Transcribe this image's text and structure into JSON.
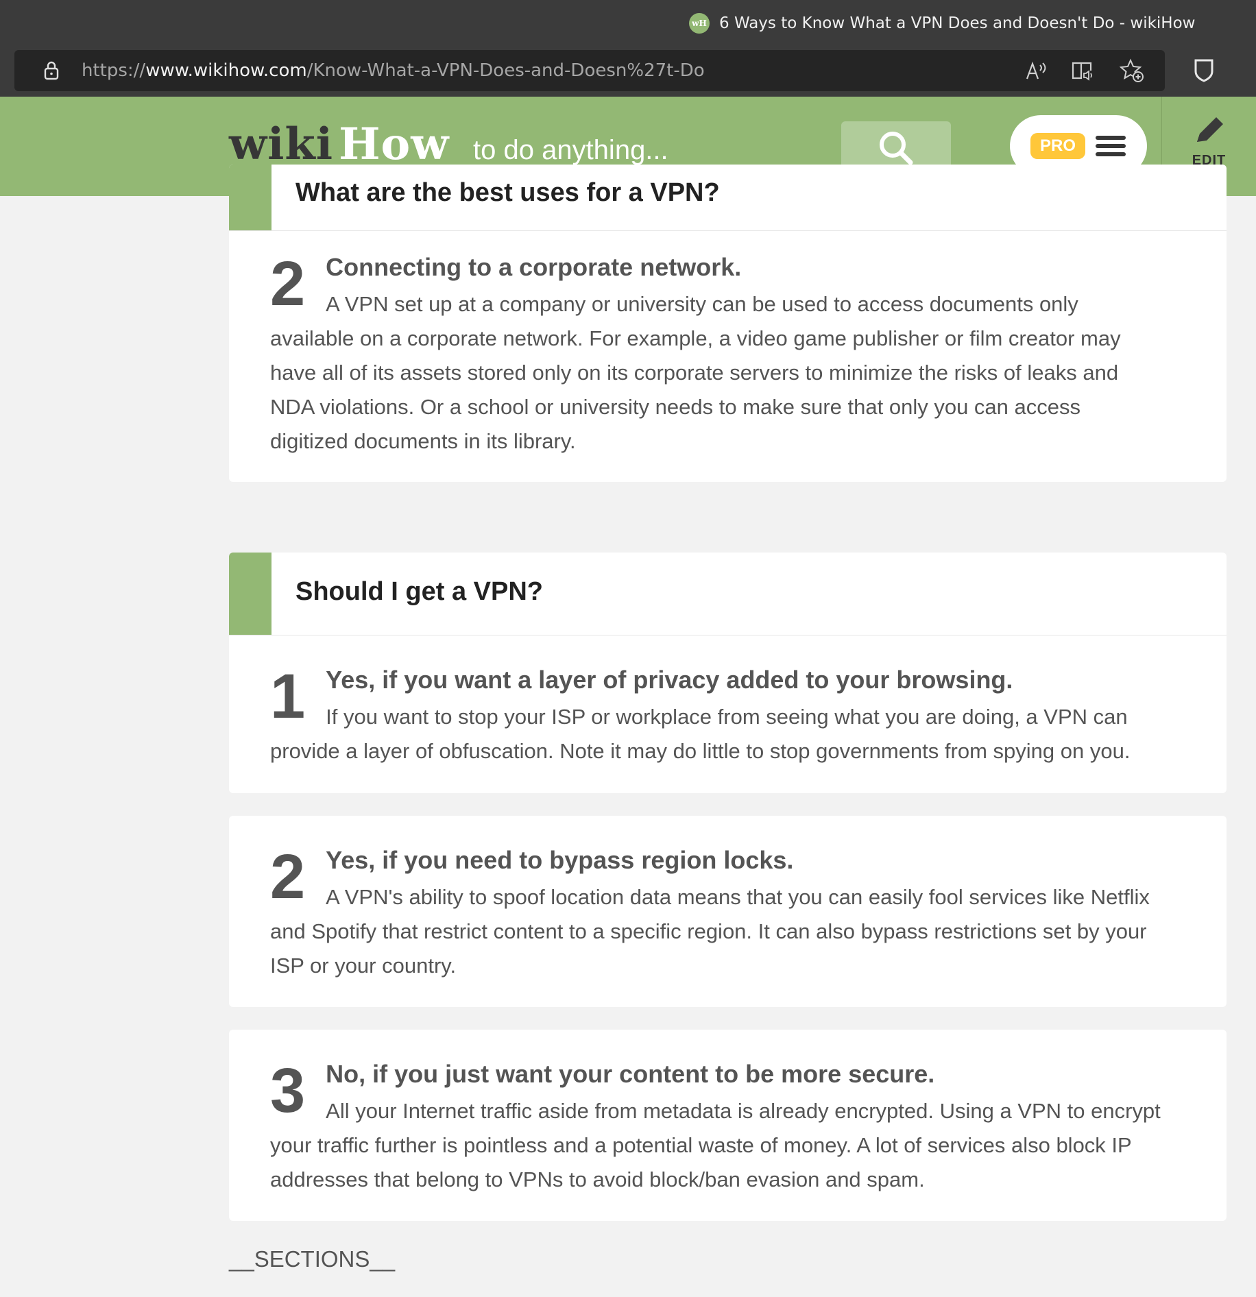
{
  "browser": {
    "tab_title": "6 Ways to Know What a VPN Does and Doesn't Do - wikiHow",
    "favicon_text": "wH",
    "url_scheme": "https://",
    "url_host": "www.wikihow.com",
    "url_path": "/Know-What-a-VPN-Does-and-Doesn%27t-Do"
  },
  "header": {
    "logo_wiki": "wiki",
    "logo_how": "How",
    "search_placeholder": "to do anything...",
    "pro_label": "PRO",
    "edit_label": "EDIT",
    "accent_color": "#93b874",
    "pro_color": "#ffc73a"
  },
  "previous_section": {
    "title": "What are the best uses for a VPN?",
    "step": {
      "number": "2",
      "title": "Connecting to a corporate network.",
      "body": "A VPN set up at a company or university can be used to access documents only available on a corporate network. For example, a video game publisher or film creator may have all of its assets stored only on its corporate servers to minimize the risks of leaks and NDA violations. Or a school or university needs to make sure that only you can access digitized documents in its library."
    }
  },
  "section": {
    "title": "Should I get a VPN?",
    "steps": [
      {
        "number": "1",
        "title": "Yes, if you want a layer of privacy added to your browsing.",
        "body": "If you want to stop your ISP or workplace from seeing what you are doing, a VPN can provide a layer of obfuscation. Note it may do little to stop governments from spying on you."
      },
      {
        "number": "2",
        "title": "Yes, if you need to bypass region locks.",
        "body": "A VPN's ability to spoof location data means that you can easily fool services like Netflix and Spotify that restrict content to a specific region. It can also bypass restrictions set by your ISP or your country."
      },
      {
        "number": "3",
        "title": "No, if you just want your content to be more secure.",
        "body": "All your Internet traffic aside from metadata is already encrypted. Using a VPN to encrypt your traffic further is pointless and a potential waste of money. A lot of services also block IP addresses that belong to VPNs to avoid block/ban evasion and spam."
      }
    ]
  },
  "footer_placeholder": "__SECTIONS__"
}
